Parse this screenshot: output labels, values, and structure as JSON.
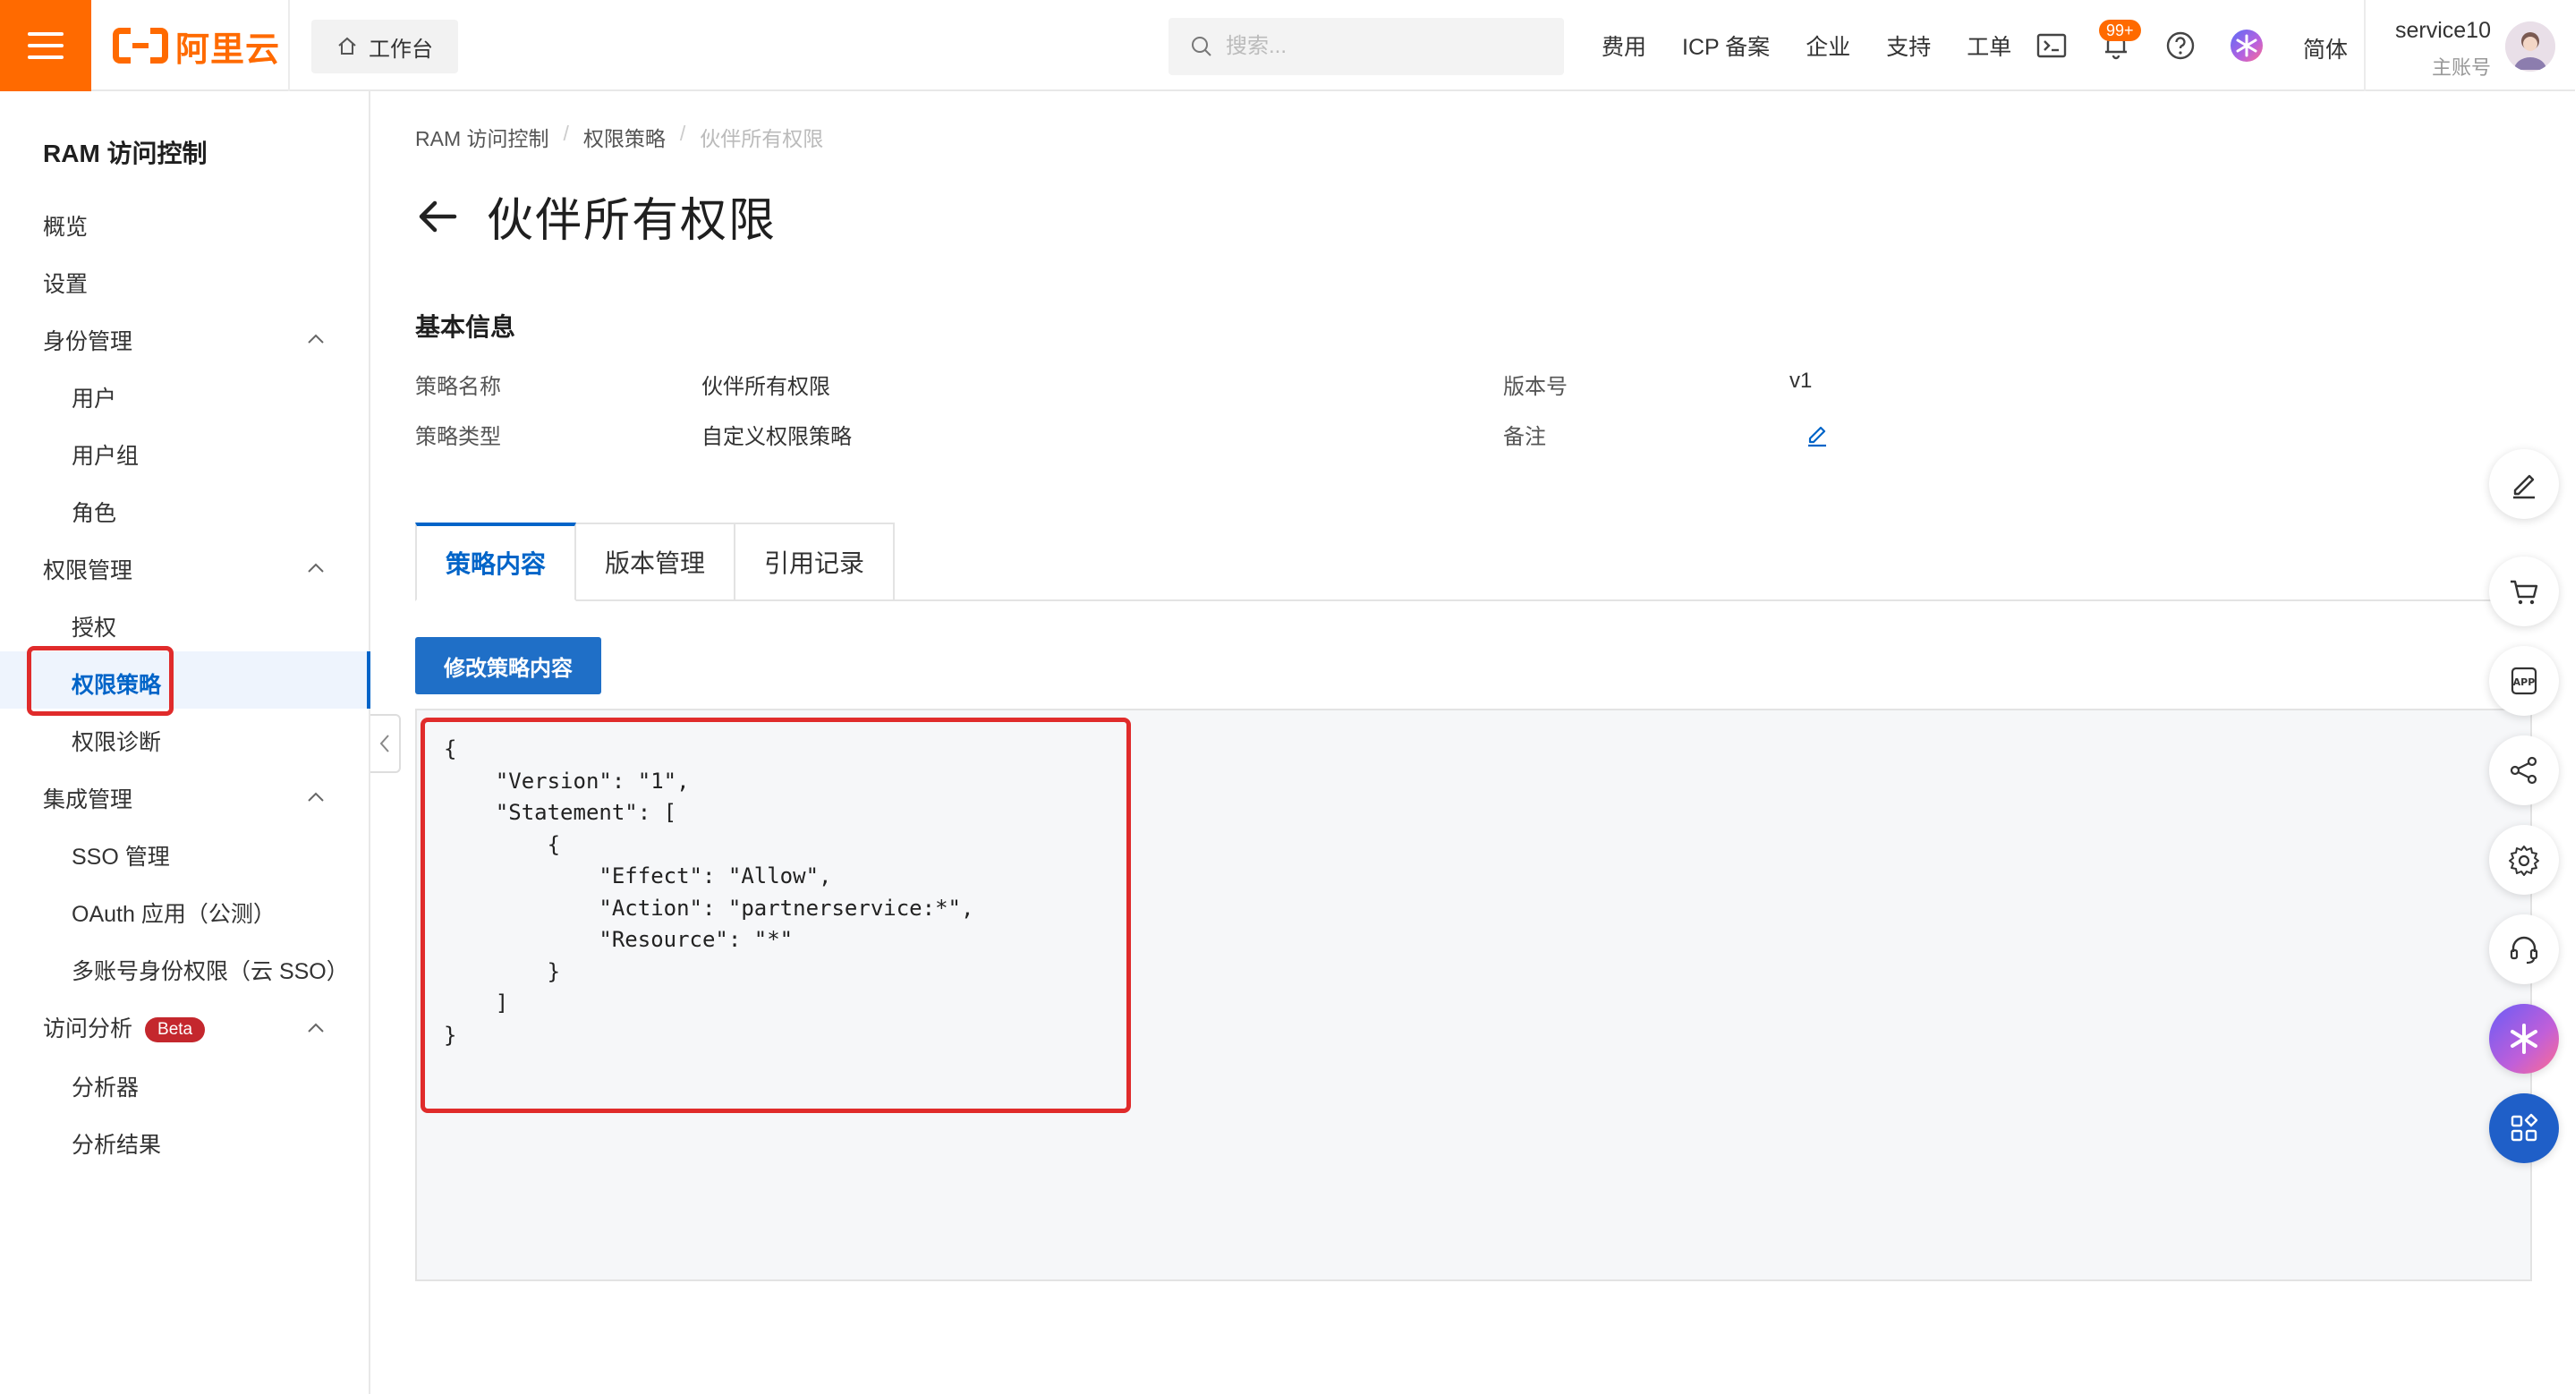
{
  "header": {
    "logo_text": "阿里云",
    "workbench_label": "工作台",
    "search_placeholder": "搜索...",
    "nav": [
      "费用",
      "ICP 备案",
      "企业",
      "支持",
      "工单"
    ],
    "notification_badge": "99+",
    "language": "简体",
    "user_name": "service10",
    "user_role": "主账号",
    "brand_color": "#ff6a00"
  },
  "sidebar": {
    "title": "RAM 访问控制",
    "items": [
      {
        "label": "概览"
      },
      {
        "label": "设置"
      },
      {
        "label": "身份管理"
      },
      {
        "label": "用户"
      },
      {
        "label": "用户组"
      },
      {
        "label": "角色"
      },
      {
        "label": "权限管理"
      },
      {
        "label": "授权"
      },
      {
        "label": "权限策略"
      },
      {
        "label": "权限诊断"
      },
      {
        "label": "集成管理"
      },
      {
        "label": "SSO 管理"
      },
      {
        "label": "OAuth 应用（公测）"
      },
      {
        "label": "多账号身份权限（云 SSO）"
      },
      {
        "label": "访问分析"
      },
      {
        "label": "分析器"
      },
      {
        "label": "分析结果"
      }
    ],
    "beta_badge": "Beta",
    "active_item": "权限策略",
    "active_color": "#0064c8"
  },
  "breadcrumb": [
    "RAM 访问控制",
    "权限策略",
    "伙伴所有权限"
  ],
  "page": {
    "title": "伙伴所有权限",
    "section_title": "基本信息",
    "fields": {
      "policy_name_label": "策略名称",
      "policy_name_value": "伙伴所有权限",
      "policy_type_label": "策略类型",
      "policy_type_value": "自定义权限策略",
      "version_label": "版本号",
      "version_value": "v1",
      "note_label": "备注"
    },
    "tabs": [
      "策略内容",
      "版本管理",
      "引用记录"
    ],
    "active_tab": "策略内容",
    "edit_button": "修改策略内容",
    "policy_document": "{\n    \"Version\": \"1\",\n    \"Statement\": [\n        {\n            \"Effect\": \"Allow\",\n            \"Action\": \"partnerservice:*\",\n            \"Resource\": \"*\"\n        }\n    ]\n}"
  },
  "float_tools": [
    "edit-icon",
    "cart-icon",
    "app-icon",
    "share-icon",
    "settings-icon",
    "headset-icon",
    "ai-assistant-icon",
    "apps-grid-icon"
  ],
  "highlight_color": "#e02b2b"
}
